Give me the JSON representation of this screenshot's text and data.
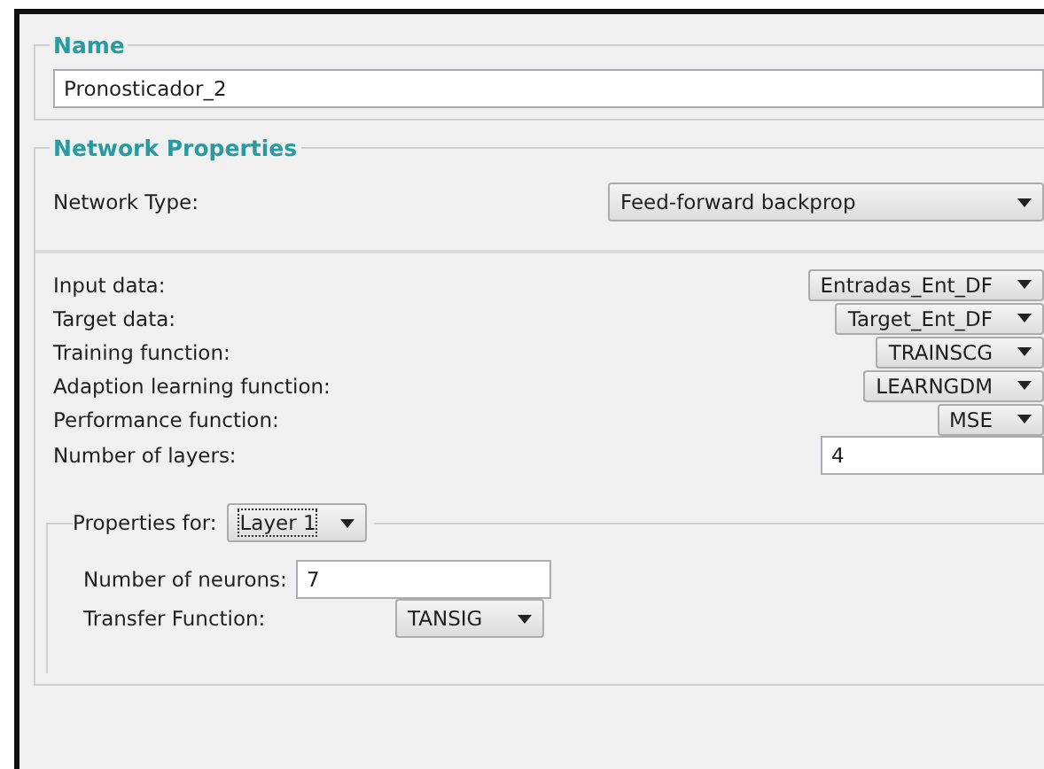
{
  "name_section": {
    "title": "Name",
    "value": "Pronosticador_2"
  },
  "network_properties": {
    "title": "Network Properties",
    "network_type": {
      "label": "Network Type:",
      "value": "Feed-forward backprop"
    },
    "fields": [
      {
        "kind": "select",
        "label": "Input data:",
        "value": "Entradas_Ent_DF"
      },
      {
        "kind": "select",
        "label": "Target data:",
        "value": "Target_Ent_DF"
      },
      {
        "kind": "select",
        "label": "Training function:",
        "value": "TRAINSCG"
      },
      {
        "kind": "select",
        "label": "Adaption learning function:",
        "value": "LEARNGDM"
      },
      {
        "kind": "select",
        "label": "Performance function:",
        "value": "MSE"
      },
      {
        "kind": "input",
        "label": "Number of layers:",
        "value": "4"
      }
    ],
    "layer_properties": {
      "label": "Properties for:",
      "layer": "Layer 1",
      "fields": [
        {
          "kind": "input",
          "label": "Number of neurons:",
          "value": "7"
        },
        {
          "kind": "select",
          "label": "Transfer Function:",
          "value": "TANSIG"
        }
      ]
    }
  }
}
